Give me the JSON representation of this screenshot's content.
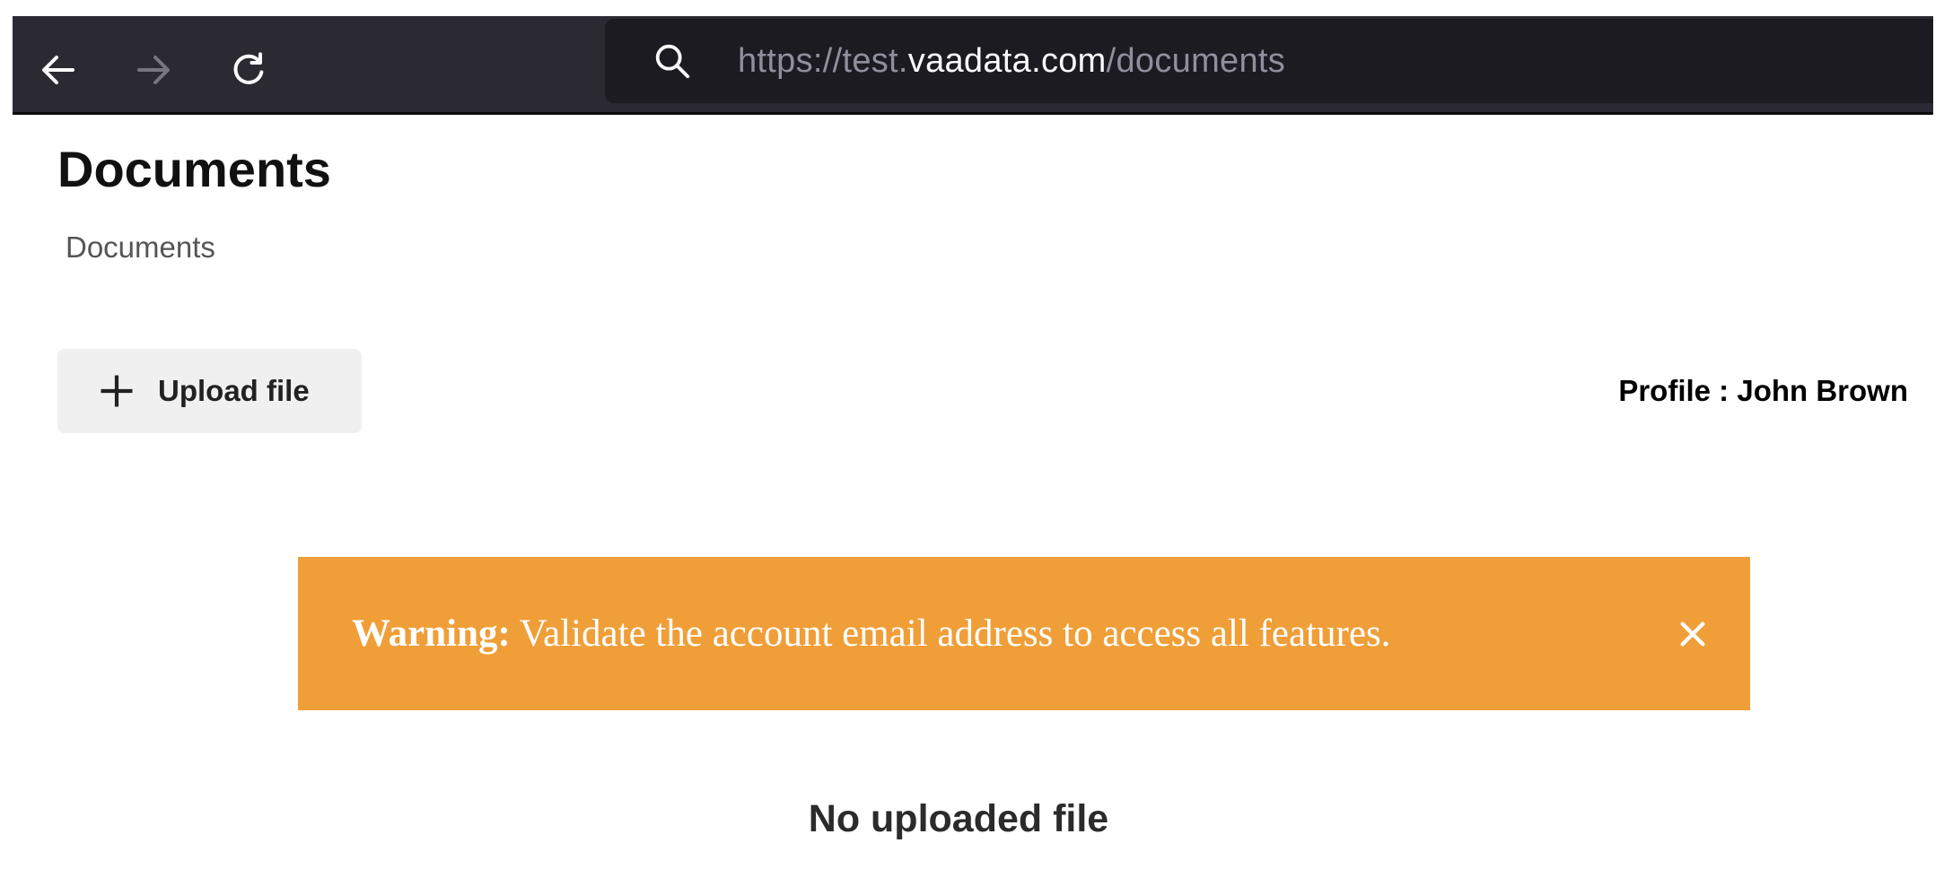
{
  "browser": {
    "url_scheme": "https://test.",
    "url_host": "vaadata.com",
    "url_path": "/documents",
    "icons": {
      "back": "arrow-left-icon",
      "forward": "arrow-right-icon",
      "reload": "reload-icon",
      "search": "search-icon"
    }
  },
  "page": {
    "title": "Documents",
    "breadcrumb": "Documents"
  },
  "toolbar": {
    "upload_label": "Upload file",
    "upload_icon": "plus-icon",
    "profile_label": "Profile : John Brown"
  },
  "warning": {
    "strong": "Warning:",
    "message": " Validate the account email address to access all features.",
    "background": "#f09e38",
    "close_icon": "close-icon"
  },
  "content": {
    "empty_message": "No uploaded file"
  }
}
